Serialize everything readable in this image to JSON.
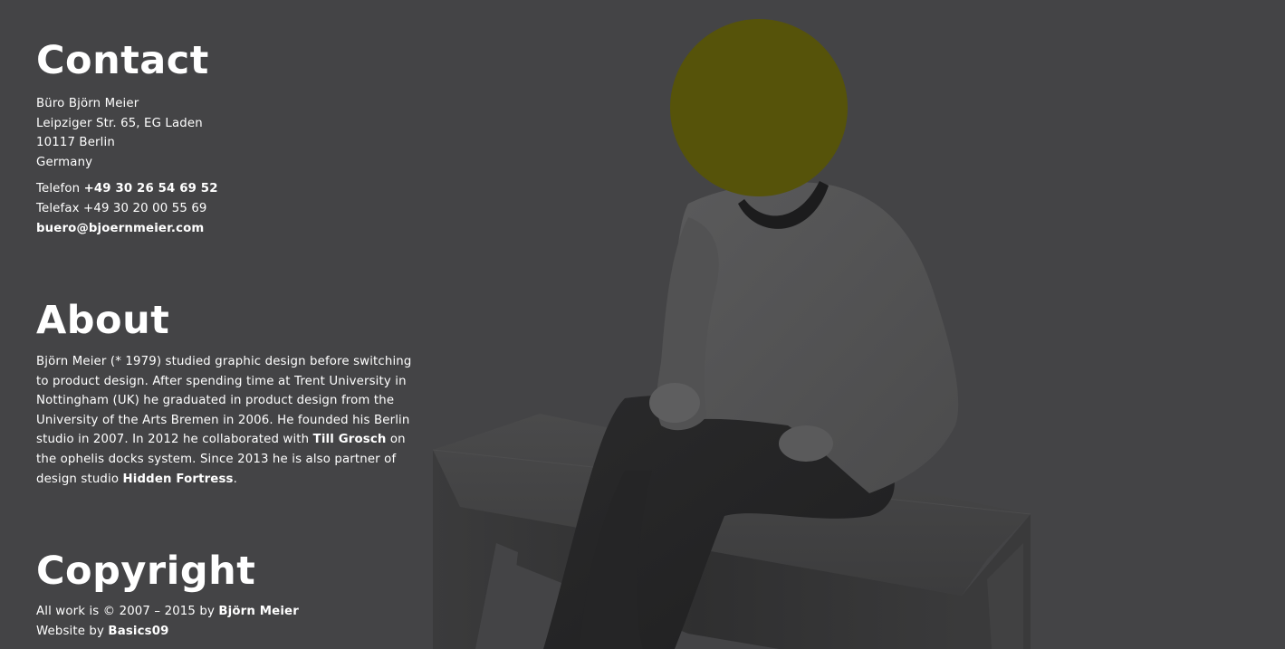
{
  "contact": {
    "heading": "Contact",
    "address": [
      "Büro Björn Meier",
      "Leipziger Str. 65, EG Laden",
      "10117 Berlin",
      "Germany"
    ],
    "phone_label": "Telefon",
    "phone_value": "+49 30 26 54 69 52",
    "fax_label": "Telefax",
    "fax_value": "+49 30 20 00 55 69",
    "email": "buero@bjoernmeier.com"
  },
  "about": {
    "heading": "About",
    "text_1": "Björn Meier (* 1979) studied graphic design before switching to product design. After spending time at Trent University in Nottingham (UK) he graduated in product design from the University of the Arts Bremen in 2006. He founded his Berlin studio in 2007. In 2012 he collaborated with ",
    "link_1": "Till Grosch",
    "text_2": " on the ophelis docks system. Since 2013 he is also partner of design studio ",
    "link_2": "Hidden Fortress",
    "text_3": "."
  },
  "copyright": {
    "heading": "Copyright",
    "line1_text": "All work is © 2007 – 2015 by ",
    "line1_name": "Björn Meier",
    "line2_text": "Website by ",
    "line2_name": "Basics09"
  },
  "colors": {
    "background": "#444446",
    "face_dot": "#56530a",
    "text": "#ffffff"
  },
  "icons": {
    "portrait": "person-on-bench-photo",
    "dot": "yellow-face-circle"
  }
}
